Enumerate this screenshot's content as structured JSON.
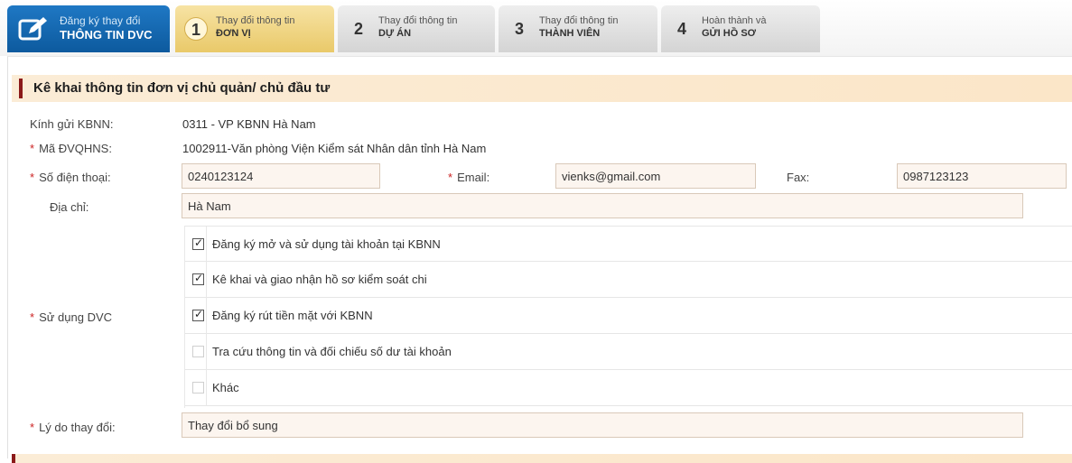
{
  "header": {
    "main_tab": {
      "line1": "Đăng ký thay đổi",
      "line2": "THÔNG TIN DVC",
      "icon": "edit-icon"
    },
    "steps": [
      {
        "num": "1",
        "line1": "Thay đổi thông tin",
        "line2": "ĐƠN VỊ",
        "active": true
      },
      {
        "num": "2",
        "line1": "Thay đổi thông tin",
        "line2": "DỰ ÁN",
        "active": false
      },
      {
        "num": "3",
        "line1": "Thay đổi thông tin",
        "line2": "THÀNH VIÊN",
        "active": false
      },
      {
        "num": "4",
        "line1": "Hoàn thành và",
        "line2": "GỬI HỒ SƠ",
        "active": false
      }
    ]
  },
  "section": {
    "title": "Kê khai thông tin đơn vị chủ quản/ chủ đầu tư"
  },
  "form": {
    "kbnn": {
      "label": "Kính gửi KBNN:",
      "value": "0311  - VP KBNN Hà Nam"
    },
    "ma_dvqhns": {
      "label": "Mã ĐVQHNS:",
      "value": "1002911-Văn phòng Viện Kiểm sát Nhân dân tỉnh Hà Nam"
    },
    "phone": {
      "label": "Số điện thoại:",
      "value": "0240123124"
    },
    "email": {
      "label": "Email:",
      "value": "vienks@gmail.com"
    },
    "fax": {
      "label": "Fax:",
      "value": "0987123123"
    },
    "address": {
      "label": "Địa chỉ:",
      "value": "Hà Nam"
    },
    "dvc": {
      "label": "Sử dụng DVC",
      "options": [
        {
          "label": "Đăng ký mở và sử dụng tài khoản tại KBNN",
          "checked": true
        },
        {
          "label": "Kê khai và giao nhận hồ sơ kiểm soát chi",
          "checked": true
        },
        {
          "label": "Đăng ký rút tiền mặt với KBNN",
          "checked": true
        },
        {
          "label": "Tra cứu thông tin và đối chiếu số dư tài khoản",
          "checked": false
        },
        {
          "label": "Khác",
          "checked": false
        }
      ]
    },
    "reason": {
      "label": "Lý do thay đổi:",
      "value": "Thay đổi bổ sung"
    },
    "required_mark": "*",
    "check_mark": "✓"
  },
  "colors": {
    "tab_blue": "#1f78c4",
    "step_active": "#e9c969",
    "section_bg": "#fbecd6",
    "section_bar": "#8b1a1a",
    "required": "#cc2222"
  }
}
